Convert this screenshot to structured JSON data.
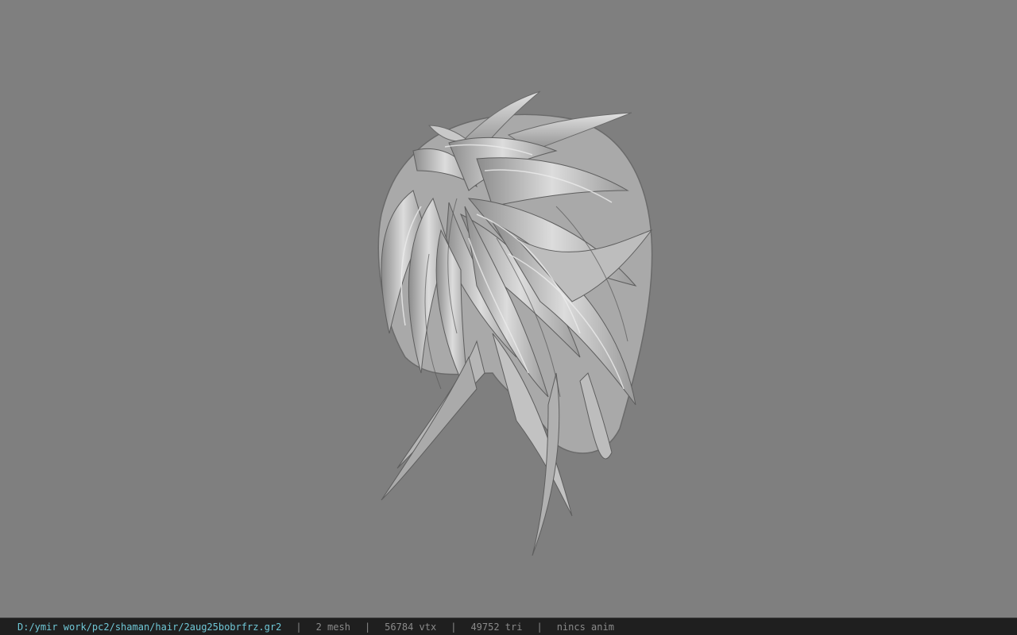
{
  "status_bar": {
    "file_path": "D:/ymir work/pc2/shaman/hair/2aug25bobrfrz.gr2",
    "separator": "|",
    "mesh_count": "2 mesh",
    "vertex_count": "56784 vtx",
    "triangle_count": "49752 tri",
    "anim_status": "nincs anim"
  },
  "colors": {
    "background": "#7f7f7f",
    "status_bar_bg": "#1f1f1f",
    "path_text": "#6fc7d6",
    "stat_text": "#8a8a8a",
    "hair_light": "#d8d8d8",
    "hair_mid": "#b4b4b4",
    "hair_dark": "#5e5e5e"
  }
}
